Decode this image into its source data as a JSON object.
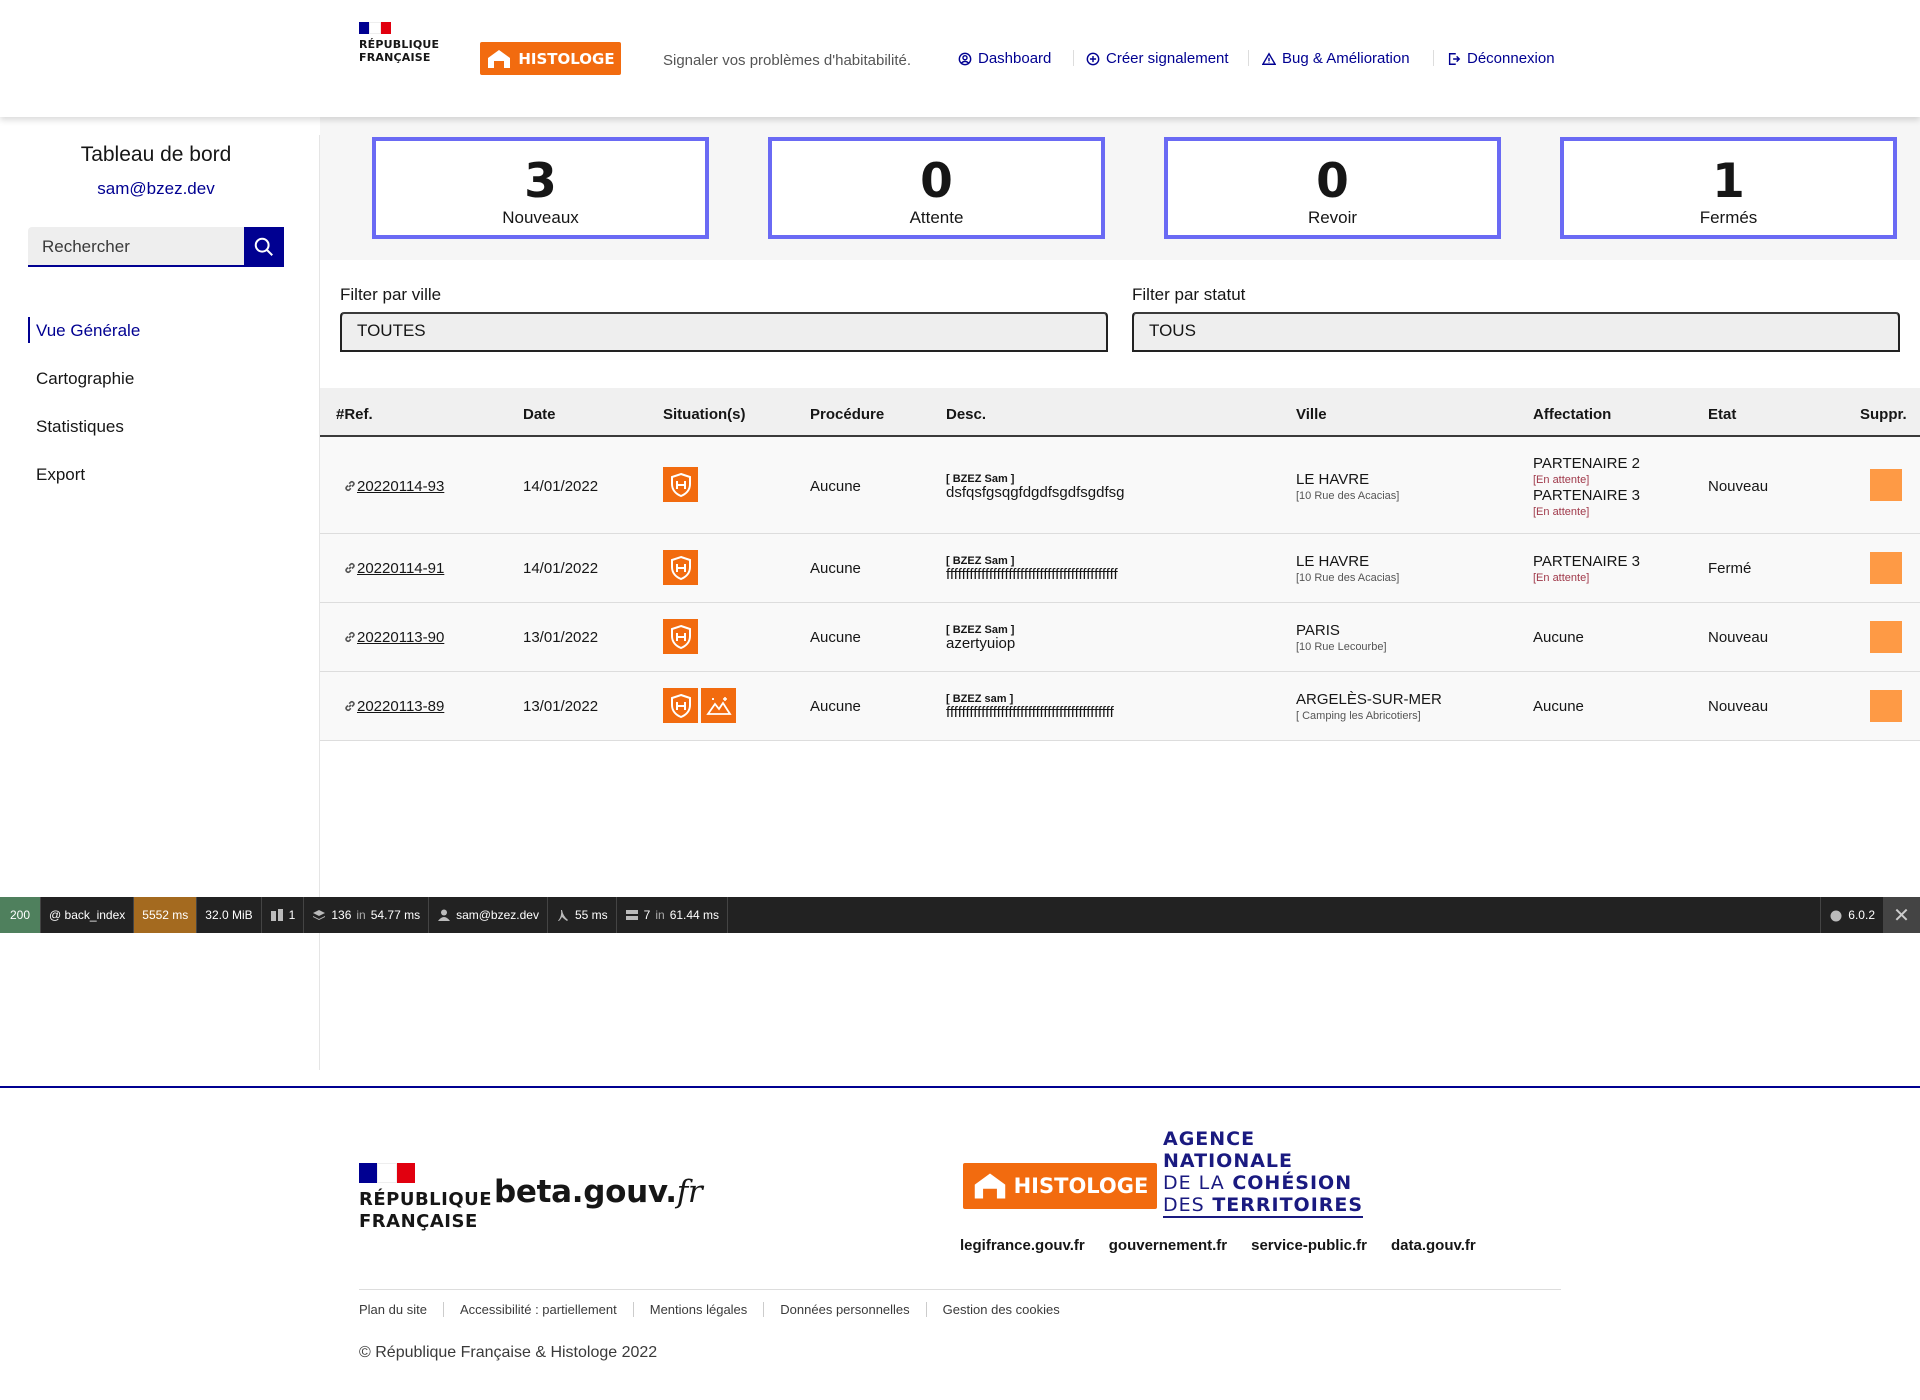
{
  "header": {
    "rf_line1": "RÉPUBLIQUE",
    "rf_line2": "FRANÇAISE",
    "brand": "HISTOLOGE",
    "tagline": "Signaler vos problèmes d'habitabilité.",
    "nav": [
      {
        "label": "Dashboard",
        "icon": "user-circle-icon"
      },
      {
        "label": "Créer signalement",
        "icon": "add-circle-icon"
      },
      {
        "label": "Bug & Amélioration",
        "icon": "warning-icon"
      },
      {
        "label": "Déconnexion",
        "icon": "logout-icon"
      }
    ]
  },
  "sidebar": {
    "title": "Tableau de bord",
    "user": "sam@bzez.dev",
    "search_placeholder": "Rechercher",
    "menu": [
      {
        "label": "Vue Générale",
        "active": true
      },
      {
        "label": "Cartographie",
        "active": false
      },
      {
        "label": "Statistiques",
        "active": false
      },
      {
        "label": "Export",
        "active": false
      }
    ]
  },
  "stats": [
    {
      "value": "3",
      "label": "Nouveaux"
    },
    {
      "value": "0",
      "label": "Attente"
    },
    {
      "value": "0",
      "label": "Revoir"
    },
    {
      "value": "1",
      "label": "Fermés"
    }
  ],
  "filters": {
    "ville_label": "Filter par ville",
    "ville_value": "TOUTES",
    "statut_label": "Filter par statut",
    "statut_value": "TOUS"
  },
  "table": {
    "headers": [
      "#Ref.",
      "Date",
      "Situation(s)",
      "Procédure",
      "Desc.",
      "Ville",
      "Affectation",
      "Etat",
      "Suppr."
    ],
    "rows": [
      {
        "ref": "20220114-93",
        "date": "14/01/2022",
        "procedure": "Aucune",
        "desc_name": "[ BZEZ Sam ]",
        "desc": "dsfqsfgsqgfdgdfsgdfsgdfsg",
        "ville": "LE HAVRE",
        "adresse": "[10 Rue des Acacias]",
        "affectation": [
          {
            "name": "PARTENAIRE 2",
            "status": "[En attente]"
          },
          {
            "name": "PARTENAIRE 3",
            "status": "[En attente]"
          }
        ],
        "etat": "Nouveau",
        "situations": 1
      },
      {
        "ref": "20220114-91",
        "date": "14/01/2022",
        "procedure": "Aucune",
        "desc_name": "[ BZEZ Sam ]",
        "desc": "ffffffffffffffffffffffffffffffffffffffffffff",
        "ville": "LE HAVRE",
        "adresse": "[10 Rue des Acacias]",
        "affectation": [
          {
            "name": "PARTENAIRE 3",
            "status": "[En attente]"
          }
        ],
        "etat": "Fermé",
        "situations": 1
      },
      {
        "ref": "20220113-90",
        "date": "13/01/2022",
        "procedure": "Aucune",
        "desc_name": "[ BZEZ Sam ]",
        "desc": "azertyuiop",
        "ville": "PARIS",
        "adresse": "[10 Rue Lecourbe]",
        "affectation_text": "Aucune",
        "etat": "Nouveau",
        "situations": 1
      },
      {
        "ref": "20220113-89",
        "date": "13/01/2022",
        "procedure": "Aucune",
        "desc_name": "[ BZEZ sam ]",
        "desc": "fffffffffffffffffffffffffffffffffffffffffff",
        "ville": "ARGELÈS-SUR-MER",
        "adresse": "[ Camping les Abricotiers]",
        "affectation_text": "Aucune",
        "etat": "Nouveau",
        "situations": 2
      }
    ]
  },
  "debug": {
    "status": "200",
    "route": "@ back_index",
    "time": "5552 ms",
    "memory": "32.0 MiB",
    "forms": "1",
    "queries": "136",
    "queries_time": "54.77 ms",
    "user": "sam@bzez.dev",
    "twig": "55 ms",
    "cache": "7",
    "cache_time": "61.44 ms",
    "version": "6.0.2",
    "in": "in",
    "mib_unit": ""
  },
  "footer": {
    "rf_line1": "RÉPUBLIQUE",
    "rf_line2": "FRANÇAISE",
    "beta_main": "beta.gouv.",
    "beta_fr": "fr",
    "brand": "HISTOLOGE",
    "anct": [
      "AGENCE",
      "NATIONALE",
      "DE LA",
      "COHÉSION",
      "DES",
      "TERRITOIRES"
    ],
    "links": [
      "legifrance.gouv.fr",
      "gouvernement.fr",
      "service-public.fr",
      "data.gouv.fr"
    ],
    "bottom": [
      "Plan du site",
      "Accessibilité : partiellement",
      "Mentions légales",
      "Données personnelles",
      "Gestion des cookies"
    ],
    "copyright": "© République Française & Histologe 2022"
  },
  "colors": {
    "accent": "#000091",
    "brand": "#f26b0f",
    "stat_border": "#6a6af4",
    "delete": "#fe9a45"
  }
}
